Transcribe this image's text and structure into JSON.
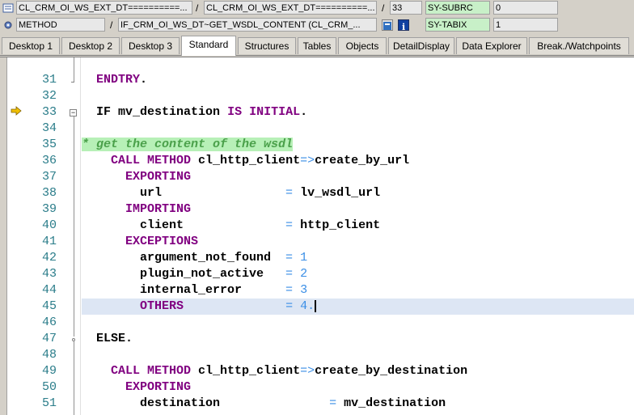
{
  "info": {
    "row1": {
      "field1": "CL_CRM_OI_WS_EXT_DT==========...",
      "sep1": "/",
      "field2": "CL_CRM_OI_WS_EXT_DT==========...",
      "sep2": "/",
      "line_no": "33",
      "var_name": "SY-SUBRC",
      "var_value": "0"
    },
    "row2": {
      "field1": "METHOD",
      "sep1": "/",
      "field2": "IF_CRM_OI_WS_DT~GET_WSDL_CONTENT (CL_CRM_...",
      "var_name": "SY-TABIX",
      "var_value": "1"
    }
  },
  "tabs": [
    {
      "label": "Desktop 1"
    },
    {
      "label": "Desktop 2"
    },
    {
      "label": "Desktop 3"
    },
    {
      "label": "Standard"
    },
    {
      "label": "Structures"
    },
    {
      "label": "Tables"
    },
    {
      "label": "Objects"
    },
    {
      "label": "DetailDisplay"
    },
    {
      "label": "Data Explorer"
    },
    {
      "label": "Break./Watchpoints"
    }
  ],
  "active_tab": "Standard",
  "colors": {
    "keyword": "#800080",
    "number": "#3a8ee6",
    "comment_bg": "#b7f0b7",
    "current_line_bg": "#dde6f4",
    "line_number": "#2b7d8a",
    "exec_arrow": "#c8a000"
  },
  "code_lines": [
    {
      "num": "31",
      "t1": "  ",
      "k1": "ENDTRY",
      "t2": "."
    },
    {
      "num": "32"
    },
    {
      "num": "33",
      "t1": "  ",
      "k1": "IF",
      "t2": " mv_destination ",
      "k2": "IS INITIAL",
      "t3": "."
    },
    {
      "num": "34"
    },
    {
      "num": "35",
      "comment": "* get the content of the wsdl"
    },
    {
      "num": "36",
      "t1": "    ",
      "k1": "CALL METHOD",
      "t2": " cl_http_client",
      "o1": "=>",
      "t3": "create_by_url"
    },
    {
      "num": "37",
      "t1": "      ",
      "k1": "EXPORTING"
    },
    {
      "num": "38",
      "t1": "        url                 ",
      "o1": "=",
      "t2": " lv_wsdl_url"
    },
    {
      "num": "39",
      "t1": "      ",
      "k1": "IMPORTING"
    },
    {
      "num": "40",
      "t1": "        client              ",
      "o1": "=",
      "t2": " http_client"
    },
    {
      "num": "41",
      "t1": "      ",
      "k1": "EXCEPTIONS"
    },
    {
      "num": "42",
      "t1": "        argument_not_found  ",
      "o1": "=",
      "n1": " 1"
    },
    {
      "num": "43",
      "t1": "        plugin_not_active   ",
      "o1": "=",
      "n1": " 2"
    },
    {
      "num": "44",
      "t1": "        internal_error      ",
      "o1": "=",
      "n1": " 3"
    },
    {
      "num": "45",
      "t1": "        ",
      "k1": "OTHERS",
      "t2": "              ",
      "o1": "=",
      "n1": " 4."
    },
    {
      "num": "46"
    },
    {
      "num": "47",
      "t1": "  ",
      "k1": "ELSE",
      "t2": "."
    },
    {
      "num": "48"
    },
    {
      "num": "49",
      "t1": "    ",
      "k1": "CALL METHOD",
      "t2": " cl_http_client",
      "o1": "=>",
      "t3": "create_by_destination"
    },
    {
      "num": "50",
      "t1": "      ",
      "k1": "EXPORTING"
    },
    {
      "num": "51",
      "t1": "        destination               ",
      "o1": "=",
      "t2": " mv_destination"
    }
  ]
}
